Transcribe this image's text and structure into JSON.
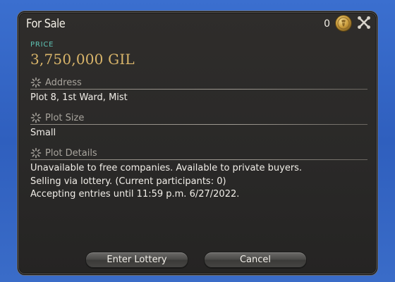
{
  "window": {
    "title": "For Sale"
  },
  "header": {
    "coin_count": "0",
    "coin_icon": "gold-coin-icon",
    "close_icon": "close-icon"
  },
  "price": {
    "label": "PRICE",
    "value": "3,750,000 GIL"
  },
  "sections": {
    "address": {
      "label": "Address",
      "value": "Plot 8, 1st Ward, Mist"
    },
    "plot_size": {
      "label": "Plot Size",
      "value": "Small"
    },
    "plot_details": {
      "label": "Plot Details",
      "lines": [
        "Unavailable to free companies. Available to private buyers.",
        "Selling via lottery. (Current participants: 0)",
        "Accepting entries until 11:59 p.m. 6/27/2022."
      ]
    }
  },
  "buttons": {
    "enter_lottery": "Enter Lottery",
    "cancel": "Cancel"
  },
  "colors": {
    "price_label": "#5fc4b5",
    "price_value": "#d9b56a",
    "section_label": "#a8a49d",
    "text": "#f1eee8",
    "backdrop": "#3f73c7"
  }
}
